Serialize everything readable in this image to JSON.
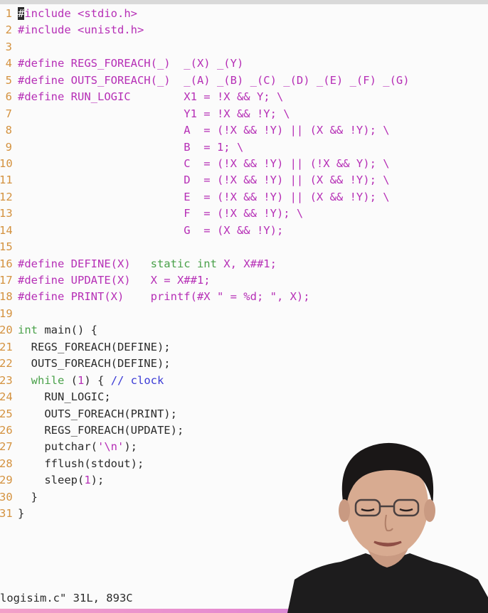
{
  "editor": {
    "lines": [
      {
        "n": "1",
        "t": "#include <stdio.h>"
      },
      {
        "n": "2",
        "t": "#include <unistd.h>"
      },
      {
        "n": "3",
        "t": ""
      },
      {
        "n": "4",
        "t": "#define REGS_FOREACH(_)  _(X) _(Y)"
      },
      {
        "n": "5",
        "t": "#define OUTS_FOREACH(_)  _(A) _(B) _(C) _(D) _(E) _(F) _(G)"
      },
      {
        "n": "6",
        "t": "#define RUN_LOGIC        X1 = !X && Y; \\"
      },
      {
        "n": "7",
        "t": "                         Y1 = !X && !Y; \\"
      },
      {
        "n": "8",
        "t": "                         A  = (!X && !Y) || (X && !Y); \\"
      },
      {
        "n": "9",
        "t": "                         B  = 1; \\"
      },
      {
        "n": "10",
        "t": "                         C  = (!X && !Y) || (!X && Y); \\"
      },
      {
        "n": "11",
        "t": "                         D  = (!X && !Y) || (X && !Y); \\"
      },
      {
        "n": "12",
        "t": "                         E  = (!X && !Y) || (X && !Y); \\"
      },
      {
        "n": "13",
        "t": "                         F  = (!X && !Y); \\"
      },
      {
        "n": "14",
        "t": "                         G  = (X && !Y);"
      },
      {
        "n": "15",
        "t": ""
      },
      {
        "n": "16",
        "t": "#define DEFINE(X)   static int X, X##1;"
      },
      {
        "n": "17",
        "t": "#define UPDATE(X)   X = X##1;"
      },
      {
        "n": "18",
        "t": "#define PRINT(X)    printf(#X \" = %d; \", X);"
      },
      {
        "n": "19",
        "t": ""
      },
      {
        "n": "20",
        "t": "int main() {"
      },
      {
        "n": "21",
        "t": "  REGS_FOREACH(DEFINE);"
      },
      {
        "n": "22",
        "t": "  OUTS_FOREACH(DEFINE);"
      },
      {
        "n": "23",
        "t": "  while (1) { // clock"
      },
      {
        "n": "24",
        "t": "    RUN_LOGIC;"
      },
      {
        "n": "25",
        "t": "    OUTS_FOREACH(PRINT);"
      },
      {
        "n": "26",
        "t": "    REGS_FOREACH(UPDATE);"
      },
      {
        "n": "27",
        "t": "    putchar('\\n');"
      },
      {
        "n": "28",
        "t": "    fflush(stdout);"
      },
      {
        "n": "29",
        "t": "    sleep(1);"
      },
      {
        "n": "30",
        "t": "  }"
      },
      {
        "n": "31",
        "t": "}"
      }
    ]
  },
  "status_line": "logisim.c\" 31L, 893C",
  "colors": {
    "line_number": "#d4923f",
    "preprocessor": "#b62fb6",
    "type": "#4aa14a",
    "comment": "#3a3ad6",
    "text": "#2b2b2b",
    "background": "#fbfbfb"
  }
}
